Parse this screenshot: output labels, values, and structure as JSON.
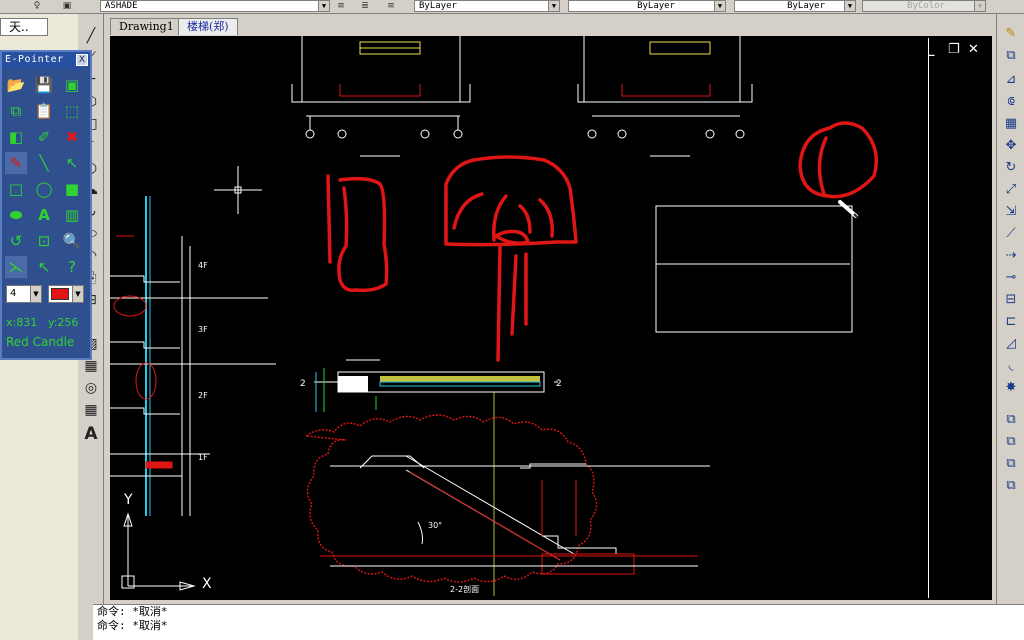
{
  "toolbar": {
    "layer_combo": "ASHADE",
    "color_combo": "ByLayer",
    "linetype_combo": "ByLayer",
    "lineweight_combo": "ByLayer",
    "plotstyle_combo": "ByColor"
  },
  "left_window": {
    "title_fragment": "天.."
  },
  "tabs": [
    {
      "label": "Drawing1"
    },
    {
      "label": "楼梯(郑)"
    }
  ],
  "epointer": {
    "title": "E-Pointer",
    "close": "X",
    "width_value": "4",
    "pen_color": "#e01515",
    "coord_x": "x:831",
    "coord_y": "y:256",
    "tool_name": "Red Candle"
  },
  "drawing": {
    "floor_labels": [
      "4F",
      "3F",
      "2F",
      "1F"
    ],
    "section_number_left": "2",
    "section_number_right": "2",
    "section_title": "2-2剖面",
    "ucs_x": "X",
    "ucs_y": "Y",
    "angle_label": "30°"
  },
  "command_lines": [
    "命令: *取消*",
    "命令: *取消*"
  ],
  "colors": {
    "canvas": "#000000",
    "annotation": "#e01515",
    "cad_line": "#ffffff",
    "stair_fill": "#e8e04a",
    "cyan": "#27c7e6"
  }
}
